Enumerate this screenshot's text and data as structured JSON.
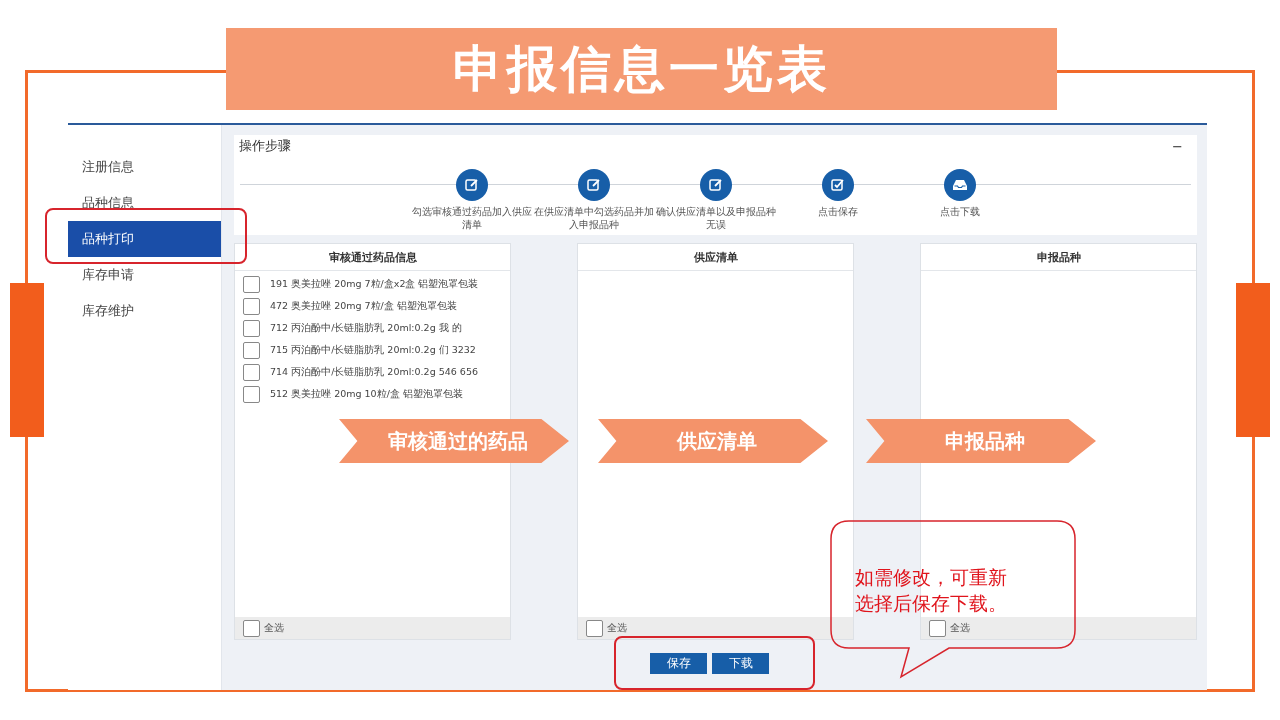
{
  "title": "申报信息一览表",
  "sidebar": {
    "items": [
      {
        "label": "注册信息",
        "selected": false
      },
      {
        "label": "品种信息",
        "selected": false
      },
      {
        "label": "品种打印",
        "selected": true
      },
      {
        "label": "库存申请",
        "selected": false
      },
      {
        "label": "库存维护",
        "selected": false
      }
    ]
  },
  "steps_panel": {
    "title": "操作步骤",
    "collapse": "−",
    "steps": [
      {
        "kind": "edit",
        "label": "勾选审核通过药品加入供应清单"
      },
      {
        "kind": "edit",
        "label": "在供应清单中勾选药品并加入申报品种"
      },
      {
        "kind": "edit",
        "label": "确认供应清单以及申报品种无误"
      },
      {
        "kind": "check",
        "label": "点击保存"
      },
      {
        "kind": "inbox",
        "label": "点击下载"
      }
    ]
  },
  "lists": [
    {
      "title": "审核通过药品信息",
      "items": [
        {
          "text": "191 奥美拉唑 20mg 7粒/盒x2盒 铝塑泡罩包装",
          "checked": false
        },
        {
          "text": "472 奥美拉唑 20mg 7粒/盒 铝塑泡罩包装",
          "checked": false
        },
        {
          "text": "712 丙泊酚中/长链脂肪乳 20ml:0.2g 我 的",
          "checked": false
        },
        {
          "text": "715 丙泊酚中/长链脂肪乳 20ml:0.2g 们 3232",
          "checked": false
        },
        {
          "text": "714 丙泊酚中/长链脂肪乳 20ml:0.2g 546 656",
          "checked": false
        },
        {
          "text": "512 奥美拉唑 20mg 10粒/盒 铝塑泡罩包装",
          "checked": false
        }
      ],
      "select_all": {
        "label": "全选",
        "checked": false
      }
    },
    {
      "title": "供应清单",
      "select_all": {
        "label": "全选",
        "checked": false
      }
    },
    {
      "title": "申报品种",
      "select_all": {
        "label": "全选",
        "checked": false
      }
    }
  ],
  "buttons": [
    "保存",
    "下载"
  ],
  "annotations": {
    "arrows": [
      "审核通过的药品",
      "供应清单",
      "申报品种"
    ],
    "note": [
      "如需修改，可重新",
      "选择后保存下载。"
    ]
  }
}
